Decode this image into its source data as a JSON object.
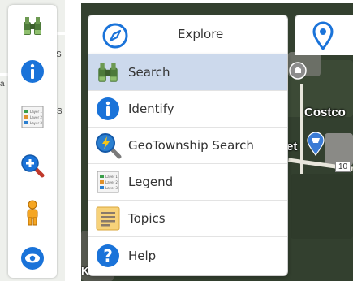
{
  "map_labels": {
    "costco": "Costco",
    "left_fragment_top": "S",
    "left_fragment_mid": "a",
    "left_fragment_low": "S",
    "left_fragment_bottom": "Ka",
    "partial_et": "et",
    "route_number": "10"
  },
  "toolbar": {
    "items": [
      {
        "icon": "binoculars-icon"
      },
      {
        "icon": "info-icon"
      },
      {
        "icon": "legend-icon"
      },
      {
        "icon": "zoom-in-icon"
      },
      {
        "icon": "street-view-person-icon"
      },
      {
        "icon": "eye-icon"
      }
    ]
  },
  "tabs": {
    "explore": {
      "label": "Explore",
      "icon": "compass-icon"
    },
    "second": {
      "icon": "map-pin-icon"
    }
  },
  "menu": {
    "items": [
      {
        "label": "Search",
        "icon": "binoculars-icon",
        "active": true
      },
      {
        "label": "Identify",
        "icon": "info-icon",
        "active": false
      },
      {
        "label": "GeoTownship Search",
        "icon": "geo-search-icon",
        "active": false
      },
      {
        "label": "Legend",
        "icon": "legend-icon",
        "active": false
      },
      {
        "label": "Topics",
        "icon": "topics-icon",
        "active": false
      },
      {
        "label": "Help",
        "icon": "help-icon",
        "active": false
      }
    ]
  },
  "legend_icon_text": {
    "line1": "Layer 1",
    "line2": "Layer 2",
    "line3": "Layer 3"
  },
  "colors": {
    "accent_blue": "#1a73d9",
    "active_row": "#ccd9ec"
  }
}
